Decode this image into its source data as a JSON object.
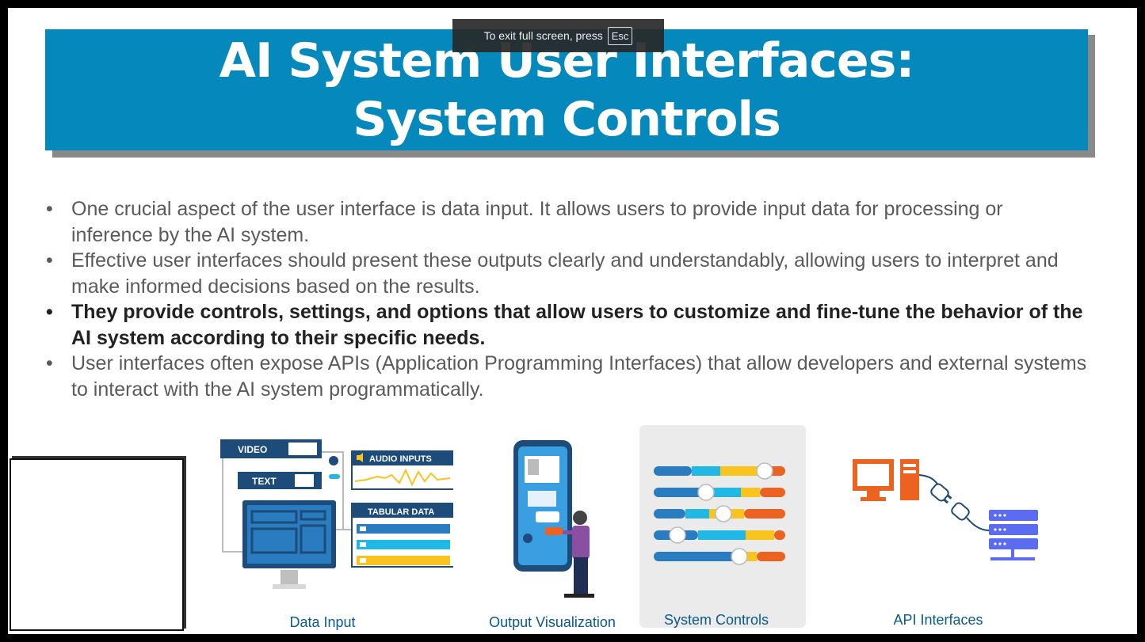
{
  "fullscreen_toast": {
    "text": "To exit full screen, press",
    "key": "Esc"
  },
  "title": {
    "line1": "AI System User Interfaces:",
    "line2": "System Controls"
  },
  "bullets": [
    {
      "text": "One crucial aspect of the user interface is data input. It allows users to provide input data for processing or inference by the AI system.",
      "bold": false
    },
    {
      "text": "Effective user interfaces should present these outputs clearly and understandably, allowing users to interpret and make informed decisions based on the results.",
      "bold": false
    },
    {
      "text": "They provide controls, settings, and options that allow users to customize and fine-tune the behavior of the AI system according to their specific needs.",
      "bold": true
    },
    {
      "text": "User interfaces often expose APIs (Application Programming Interfaces) that allow developers and external systems to interact with the AI system programmatically.",
      "bold": false
    }
  ],
  "bullet_symbol": "•",
  "panels": {
    "data_input": {
      "label": "Data Input",
      "video_label": "VIDEO",
      "text_label": "TEXT",
      "audio_label": "AUDIO INPUTS",
      "tabular_label": "TABULAR DATA"
    },
    "output_visualization": {
      "label": "Output Visualization"
    },
    "system_controls": {
      "label": "System Controls",
      "highlighted": true
    },
    "api_interfaces": {
      "label": "API Interfaces"
    }
  },
  "colors": {
    "title_bg": "#0588bb",
    "title_shadow": "#8a8a8a",
    "dark_navy": "#1d4b7a",
    "accent_blue": "#2a7cc0",
    "cyan": "#22b8e6",
    "yellow": "#f8c41d",
    "orange": "#ec6220",
    "purple": "#8a4fa0",
    "server_blue": "#5b6cf0"
  }
}
